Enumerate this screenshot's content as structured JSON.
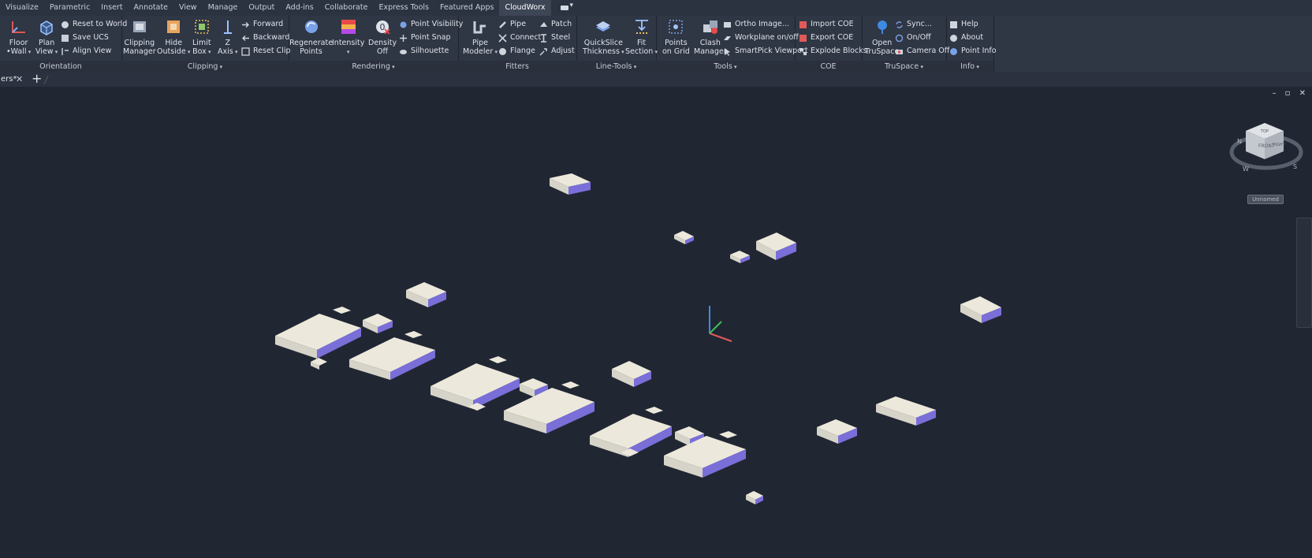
{
  "menu": {
    "tabs": [
      "Visualize",
      "Parametric",
      "Insert",
      "Annotate",
      "View",
      "Manage",
      "Output",
      "Add-ins",
      "Collaborate",
      "Express Tools",
      "Featured Apps",
      "CloudWorx"
    ],
    "active_tab": "CloudWorx"
  },
  "ribbon": {
    "orientation": {
      "title": "Orientation",
      "floor_wall": [
        "Floor",
        "•Wall"
      ],
      "plan_view": [
        "Plan",
        "View"
      ],
      "reset_to_world": "Reset to World",
      "save_ucs": "Save UCS",
      "align_view": "Align View"
    },
    "clipping": {
      "title": "Clipping",
      "clipping_manager": [
        "Clipping",
        "Manager"
      ],
      "hide_outside": [
        "Hide",
        "Outside"
      ],
      "limit_box": [
        "Limit",
        "Box"
      ],
      "z_axis": [
        "Z",
        "Axis"
      ],
      "forward": "Forward",
      "backward": "Backward",
      "reset_clip": "Reset Clip"
    },
    "rendering": {
      "title": "Rendering",
      "regenerate_points": [
        "Regenerate",
        "Points"
      ],
      "intensity": "Intensity",
      "density_off": [
        "Density",
        "Off"
      ],
      "point_visibility": "Point Visibility",
      "point_snap": "Point Snap",
      "silhouette": "Silhouette"
    },
    "fitters": {
      "title": "Fitters",
      "pipe_modeler": [
        "Pipe",
        "Modeler"
      ],
      "pipe": "Pipe",
      "connect": "Connect",
      "flange": "Flange",
      "patch": "Patch",
      "steel": "Steel",
      "adjust": "Adjust"
    },
    "line_tools": {
      "title": "Line-Tools",
      "quickslice_thickness": [
        "QuickSlice",
        "Thickness"
      ],
      "fit_section": [
        "Fit",
        "Section"
      ]
    },
    "tools": {
      "title": "Tools",
      "points_on_grid": [
        "Points",
        "on Grid"
      ],
      "clash_manager": [
        "Clash",
        "Manager"
      ],
      "ortho_image": "Ortho Image...",
      "workplane_onoff": "Workplane on/off",
      "smartpick_viewport": "SmartPick Viewport"
    },
    "coe": {
      "title": "COE",
      "import_coe": "Import COE",
      "export_coe": "Export COE",
      "explode_blocks": "Explode Blocks"
    },
    "truspace": {
      "title": "TruSpace",
      "open_truspace": [
        "Open",
        "TruSpace"
      ],
      "sync": "Sync...",
      "on_off": "On/Off",
      "camera_off": "Camera Off"
    },
    "info": {
      "title": "Info",
      "help": "Help",
      "about": "About",
      "point_info": "Point Info"
    }
  },
  "doc_tab": {
    "label": "ers*",
    "close": "✕",
    "new_tab": "+"
  },
  "viewport": {
    "window_controls": "– ▫ ✕",
    "viewcube": {
      "top": "TOP",
      "front": "FRONT",
      "right": "RIGHT",
      "compass_n": "N",
      "compass_w": "W",
      "compass_s": "S"
    },
    "named_view": "Unnamed"
  },
  "colors": {
    "background": "#212633",
    "box_top": "#ece9dc",
    "box_side": "#7a6ed8",
    "ribbon": "#2f3644"
  }
}
